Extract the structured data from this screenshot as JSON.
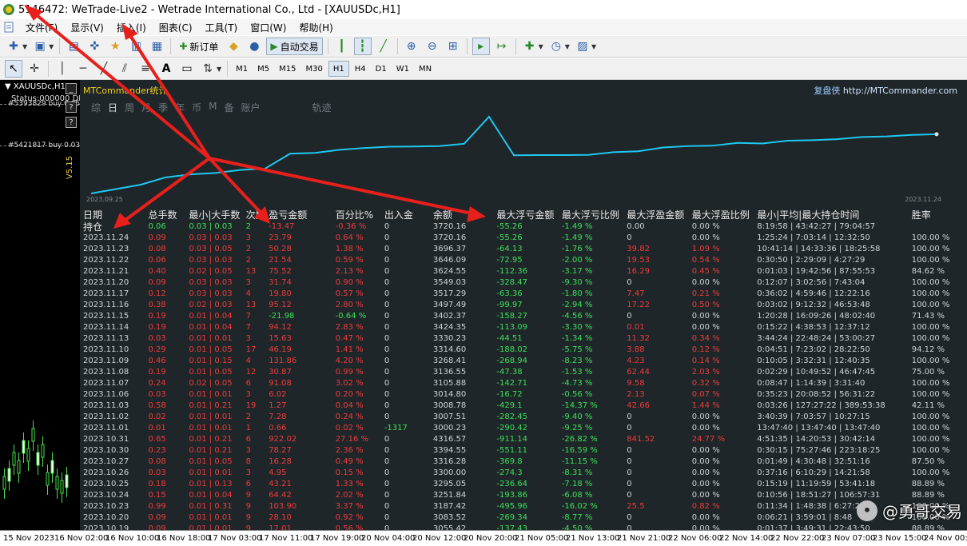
{
  "window": {
    "title": "5146472: WeTrade-Live2 - Wetrade International Co., Ltd - [XAUUSDc,H1]"
  },
  "menu": {
    "items": [
      "文件(F)",
      "显示(V)",
      "插入(I)",
      "图表(C)",
      "工具(T)",
      "窗口(W)",
      "帮助(H)"
    ]
  },
  "toolbar": {
    "new_order": "新订单",
    "auto_trade": "自动交易"
  },
  "timeframes": {
    "items": [
      "M1",
      "M5",
      "M15",
      "M30",
      "H1",
      "H4",
      "D1",
      "W1",
      "MN"
    ],
    "active": "H1"
  },
  "chart": {
    "symbol": "XAUUSDc,H1",
    "status": "Status:000000 DII",
    "order1": "#5393829 buy 0.05",
    "order2": "#5421817 buy 0.03",
    "version": "V5.15",
    "side_buttons": [
      "_",
      "?",
      "?"
    ]
  },
  "stats": {
    "title": "MTCommander统计",
    "brand_cn": "复盘侠",
    "brand_url": "http://MTCommander.com",
    "tabs": [
      "综",
      "日",
      "周",
      "月",
      "季",
      "年",
      "币",
      "M",
      "备",
      "账户",
      "轨迹"
    ],
    "active_tab": "日",
    "date_start": "2023.09.25",
    "date_end": "2023.11.24",
    "line_color": "#1ec8f0",
    "columns": [
      "日期",
      "总手数",
      "最小|大手数",
      "次数",
      "盈亏金额",
      "百分比%",
      "出入金",
      "余额",
      "最大浮亏金额",
      "最大浮亏比例",
      "最大浮盈金额",
      "最大浮盈比例",
      "最小|平均|最大持仓时间",
      "胜率"
    ],
    "holding": [
      "持仓",
      "0.06",
      "0.03 | 0.03",
      "2",
      "-13.47",
      "-0.36 %",
      "0",
      "3720.16",
      "-55.26",
      "-1.49 %",
      "0.00",
      "0.00 %",
      "8:19:58 | 43:42:27 | 79:04:57",
      ""
    ],
    "rows": [
      [
        "2023.11.24",
        "0.09",
        "0.03 | 0.03",
        "3",
        "23.79",
        "0.64 %",
        "0",
        "3720.16",
        "-55.26",
        "-1.49 %",
        "0",
        "0.00 %",
        "1:25:24 | 7:03:14 | 12:32:50",
        "100.00 %"
      ],
      [
        "2023.11.23",
        "0.08",
        "0.03 | 0.05",
        "2",
        "50.28",
        "1.38 %",
        "0",
        "3696.37",
        "-64.13",
        "-1.76 %",
        "39.82",
        "1.09 %",
        "10:41:14 | 14:33:36 | 18:25:58",
        "100.00 %"
      ],
      [
        "2023.11.22",
        "0.06",
        "0.03 | 0.03",
        "2",
        "21.54",
        "0.59 %",
        "0",
        "3646.09",
        "-72.95",
        "-2.00 %",
        "19.53",
        "0.54 %",
        "0:30:50 | 2:29:09 | 4:27:29",
        "100.00 %"
      ],
      [
        "2023.11.21",
        "0.40",
        "0.02 | 0.05",
        "13",
        "75.52",
        "2.13 %",
        "0",
        "3624.55",
        "-112.36",
        "-3.17 %",
        "16.29",
        "0.45 %",
        "0:01:03 | 19:42:56 | 87:55:53",
        "84.62 %"
      ],
      [
        "2023.11.20",
        "0.09",
        "0.03 | 0.03",
        "3",
        "31.74",
        "0.90 %",
        "0",
        "3549.03",
        "-328.47",
        "-9.30 %",
        "0",
        "0.00 %",
        "0:12:07 | 3:02:56 | 7:43:04",
        "100.00 %"
      ],
      [
        "2023.11.17",
        "0.12",
        "0.03 | 0.03",
        "4",
        "19.80",
        "0.57 %",
        "0",
        "3517.29",
        "-63.36",
        "-1.80 %",
        "7.47",
        "0.21 %",
        "0:36:02 | 4:59:46 | 12:22:16",
        "100.00 %"
      ],
      [
        "2023.11.16",
        "0.38",
        "0.02 | 0.03",
        "13",
        "95.12",
        "2.80 %",
        "0",
        "3497.49",
        "-99.97",
        "-2.94 %",
        "17.22",
        "0.50 %",
        "0:03:02 | 9:12:32 | 46:53:48",
        "100.00 %"
      ],
      [
        "2023.11.15",
        "0.19",
        "0.01 | 0.04",
        "7",
        "-21.98",
        "-0.64 %",
        "0",
        "3402.37",
        "-158.27",
        "-4.56 %",
        "0",
        "0.00 %",
        "1:20:28 | 16:09:26 | 48:02:40",
        "71.43 %"
      ],
      [
        "2023.11.14",
        "0.19",
        "0.01 | 0.04",
        "7",
        "94.12",
        "2.83 %",
        "0",
        "3424.35",
        "-113.09",
        "-3.30 %",
        "0.01",
        "0.00 %",
        "0:15:22 | 4:38:53 | 12:37:12",
        "100.00 %"
      ],
      [
        "2023.11.13",
        "0.03",
        "0.01 | 0.01",
        "3",
        "15.63",
        "0.47 %",
        "0",
        "3330.23",
        "-44.51",
        "-1.34 %",
        "11.32",
        "0.34 %",
        "3:44:24 | 22:48:24 | 53:00:27",
        "100.00 %"
      ],
      [
        "2023.11.10",
        "0.29",
        "0.01 | 0.05",
        "17",
        "46.19",
        "1.41 %",
        "0",
        "3314.60",
        "-188.02",
        "-5.75 %",
        "3.88",
        "0.12 %",
        "0:04:51 | 7:23:02 | 28:22:50",
        "94.12 %"
      ],
      [
        "2023.11.09",
        "0.46",
        "0.01 | 0.15",
        "4",
        "131.86",
        "4.20 %",
        "0",
        "3268.41",
        "-268.94",
        "-8.23 %",
        "4.23",
        "0.14 %",
        "0:10:05 | 3:32:31 | 12:40:35",
        "100.00 %"
      ],
      [
        "2023.11.08",
        "0.19",
        "0.01 | 0.05",
        "12",
        "30.87",
        "0.99 %",
        "0",
        "3136.55",
        "-47.38",
        "-1.53 %",
        "62.44",
        "2.03 %",
        "0:02:29 | 10:49:52 | 46:47:45",
        "75.00 %"
      ],
      [
        "2023.11.07",
        "0.24",
        "0.02 | 0.05",
        "6",
        "91.08",
        "3.02 %",
        "0",
        "3105.88",
        "-142.71",
        "-4.73 %",
        "9.58",
        "0.32 %",
        "0:08:47 | 1:14:39 | 3:31:40",
        "100.00 %"
      ],
      [
        "2023.11.06",
        "0.03",
        "0.01 | 0.01",
        "3",
        "6.02",
        "0.20 %",
        "0",
        "3014.80",
        "-16.72",
        "-0.56 %",
        "2.13",
        "0.07 %",
        "0:35:23 | 20:08:52 | 56:31:22",
        "100.00 %"
      ],
      [
        "2023.11.03",
        "0.58",
        "0.01 | 0.21",
        "19",
        "1.27",
        "0.04 %",
        "0",
        "3008.78",
        "-429.1",
        "-14.37 %",
        "42.66",
        "1.44 %",
        "0:03:26 | 127:27:22 | 389:53:38",
        "42.11 %"
      ],
      [
        "2023.11.02",
        "0.02",
        "0.01 | 0.01",
        "2",
        "7.28",
        "0.24 %",
        "0",
        "3007.51",
        "-282.45",
        "-9.40 %",
        "0",
        "0.00 %",
        "3:40:39 | 7:03:57 | 10:27:15",
        "100.00 %"
      ],
      [
        "2023.11.01",
        "0.01",
        "0.01 | 0.01",
        "1",
        "0.66",
        "0.02 %",
        "-1317",
        "3000.23",
        "-290.42",
        "-9.25 %",
        "0",
        "0.00 %",
        "13:47:40 | 13:47:40 | 13:47:40",
        "100.00 %"
      ],
      [
        "2023.10.31",
        "0.65",
        "0.01 | 0.21",
        "6",
        "922.02",
        "27.16 %",
        "0",
        "4316.57",
        "-911.14",
        "-26.82 %",
        "841.52",
        "24.77 %",
        "4:51:35 | 14:20:53 | 30:42:14",
        "100.00 %"
      ],
      [
        "2023.10.30",
        "0.23",
        "0.01 | 0.21",
        "3",
        "78.27",
        "2.36 %",
        "0",
        "3394.55",
        "-551.11",
        "-16.59 %",
        "0",
        "0.00 %",
        "0:30:15 | 75:27:46 | 223:18:25",
        "100.00 %"
      ],
      [
        "2023.10.27",
        "0.08",
        "0.01 | 0.05",
        "8",
        "16.28",
        "0.49 %",
        "0",
        "3316.28",
        "-369.8",
        "-11.15 %",
        "0",
        "0.00 %",
        "0:01:49 | 4:30:48 | 32:51:16",
        "87.50 %"
      ],
      [
        "2023.10.26",
        "0.03",
        "0.01 | 0.01",
        "3",
        "4.95",
        "0.15 %",
        "0",
        "3300.00",
        "-274.3",
        "-8.31 %",
        "0",
        "0.00 %",
        "0:37:16 | 6:10:29 | 14:21:58",
        "100.00 %"
      ],
      [
        "2023.10.25",
        "0.18",
        "0.01 | 0.13",
        "6",
        "43.21",
        "1.33 %",
        "0",
        "3295.05",
        "-236.64",
        "-7.18 %",
        "0",
        "0.00 %",
        "0:15:19 | 11:19:59 | 53:41:18",
        "88.89 %"
      ],
      [
        "2023.10.24",
        "0.15",
        "0.01 | 0.04",
        "9",
        "64.42",
        "2.02 %",
        "0",
        "3251.84",
        "-193.86",
        "-6.08 %",
        "0",
        "0.00 %",
        "0:10:56 | 18:51:27 | 106:57:31",
        "88.89 %"
      ],
      [
        "2023.10.23",
        "0.99",
        "0.01 | 0.31",
        "9",
        "103.90",
        "3.37 %",
        "0",
        "3187.42",
        "-495.96",
        "-16.02 %",
        "25.5",
        "0.82 %",
        "0:11:34 | 1:48:38 | 6:27:2",
        "100.00 %"
      ],
      [
        "2023.10.20",
        "0.09",
        "0.01 | 0.01",
        "9",
        "28.10",
        "0.92 %",
        "0",
        "3083.52",
        "-269.34",
        "-8.77 %",
        "0",
        "0.00 %",
        "0:06:21 | 3:59:01 | 8:48",
        "100.00 %"
      ],
      [
        "2023.10.19",
        "0.09",
        "0.01 | 0.01",
        "9",
        "17.01",
        "0.56 %",
        "0",
        "3055.42",
        "-137.43",
        "-4.50 %",
        "0",
        "0.00 %",
        "0:01:37 | 3:49:31 | 22:43:50",
        "88.89 %"
      ]
    ]
  },
  "chart_data": {
    "type": "line",
    "x": [
      "2023.09.25",
      "2023.09.27",
      "2023.09.29",
      "2023.10.02",
      "2023.10.05",
      "2023.10.09",
      "2023.10.12",
      "2023.10.16",
      "2023.10.19",
      "2023.10.20",
      "2023.10.23",
      "2023.10.24",
      "2023.10.25",
      "2023.10.26",
      "2023.10.27",
      "2023.10.30",
      "2023.10.31",
      "2023.11.01",
      "2023.11.02",
      "2023.11.03",
      "2023.11.06",
      "2023.11.07",
      "2023.11.08",
      "2023.11.09",
      "2023.11.10",
      "2023.11.13",
      "2023.11.14",
      "2023.11.15",
      "2023.11.16",
      "2023.11.17",
      "2023.11.20",
      "2023.11.21",
      "2023.11.22",
      "2023.11.23",
      "2023.11.24"
    ],
    "series": [
      {
        "values": [
          1700,
          1850,
          2000,
          2250,
          2350,
          2400,
          2500,
          2550,
          3055.42,
          3083.52,
          3187.42,
          3251.84,
          3295.05,
          3300,
          3316.28,
          3394.55,
          4316.57,
          3000.23,
          3007.51,
          3008.78,
          3014.8,
          3105.88,
          3136.55,
          3268.41,
          3314.6,
          3330.23,
          3424.35,
          3402.37,
          3497.49,
          3517.29,
          3549.03,
          3624.55,
          3646.09,
          3696.37,
          3720.16
        ]
      }
    ],
    "xlim": [
      "2023.09.25",
      "2023.11.24"
    ]
  },
  "timeaxis": {
    "ticks": [
      "15 Nov 2023",
      "16 Nov 02:00",
      "16 Nov 10:00",
      "16 Nov 18:00",
      "17 Nov 03:00",
      "17 Nov 11:00",
      "17 Nov 19:00",
      "20 Nov 04:00",
      "20 Nov 12:00",
      "20 Nov 20:00",
      "21 Nov 05:00",
      "21 Nov 13:00",
      "21 Nov 21:00",
      "22 Nov 06:00",
      "22 Nov 14:00",
      "22 Nov 22:00",
      "23 Nov 07:00",
      "23 Nov 15:00",
      "24 Nov 00:00"
    ]
  },
  "watermark": {
    "text": "@勇哥交易"
  }
}
